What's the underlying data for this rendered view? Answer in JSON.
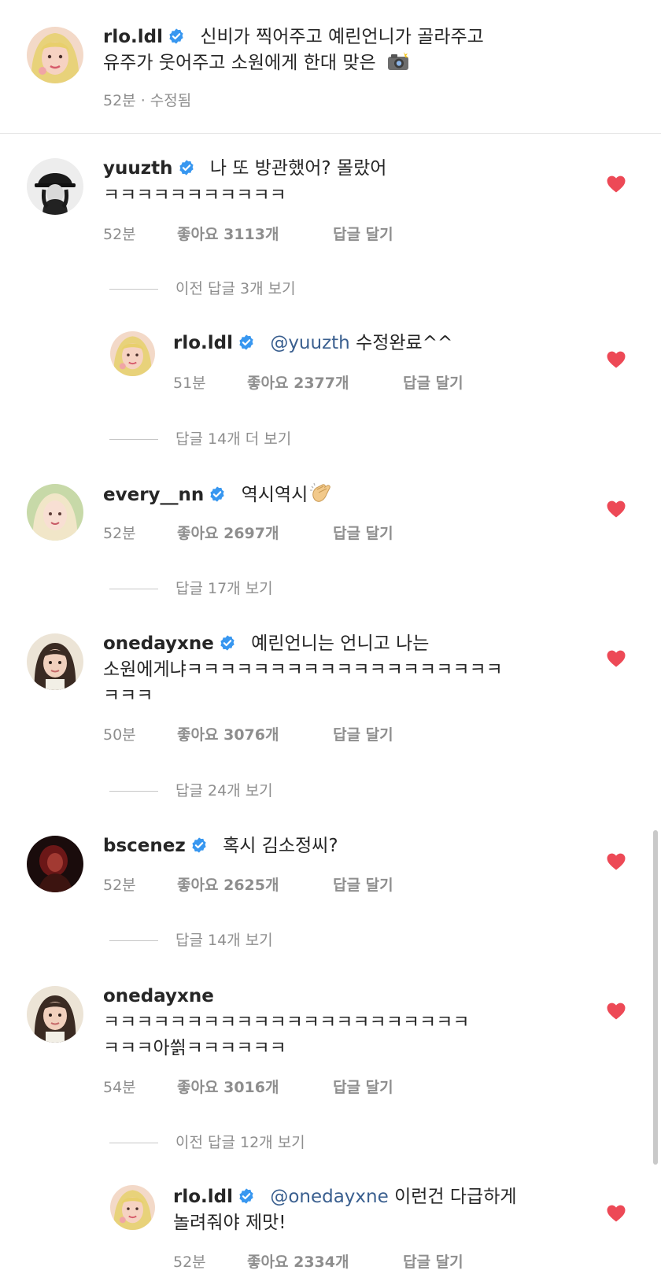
{
  "caption": {
    "username": "rlo.ldl",
    "text_line1": "신비가 찍어주고 예린언니가 골라주고",
    "text_line2": "유주가 웃어주고 소원에게 한대 맞은",
    "emoji": "camera-with-flash-icon",
    "meta": "52분 · 수정됨"
  },
  "comments": [
    {
      "username": "yuuzth",
      "text_line1": "나 또 방관했어? 몰랐어",
      "text_line2": "ㅋㅋㅋㅋㅋㅋㅋㅋㅋㅋㅋ",
      "time": "52분",
      "likes": "좋아요 3113개",
      "reply": "답글 달기",
      "view_replies": "이전 답글 3개 보기"
    },
    {
      "username": "rlo.ldl",
      "mention": "@yuuzth",
      "text_line1": "수정완료^^",
      "time": "51분",
      "likes": "좋아요 2377개",
      "reply": "답글 달기",
      "view_replies": "답글 14개 더 보기"
    },
    {
      "username": "every__nn",
      "text_line1": "역시역시",
      "emoji": "clapping-hands-icon",
      "time": "52분",
      "likes": "좋아요 2697개",
      "reply": "답글 달기",
      "view_replies": "답글 17개 보기"
    },
    {
      "username": "onedayxne",
      "text_line1": "예린언니는 언니고 나는",
      "text_line2": "소원에게냐ㅋㅋㅋㅋㅋㅋㅋㅋㅋㅋㅋㅋㅋㅋㅋㅋㅋㅋㅋ",
      "text_line3": "ㅋㅋㅋ",
      "time": "50분",
      "likes": "좋아요 3076개",
      "reply": "답글 달기",
      "view_replies": "답글 24개 보기"
    },
    {
      "username": "bscenez",
      "text_line1": "혹시 김소정씨?",
      "time": "52분",
      "likes": "좋아요 2625개",
      "reply": "답글 달기",
      "view_replies": "답글 14개 보기"
    },
    {
      "username": "onedayxne",
      "text_line1": "ㅋㅋㅋㅋㅋㅋㅋㅋㅋㅋㅋㅋㅋㅋㅋㅋㅋㅋㅋㅋㅋㅋ",
      "text_line2": "ㅋㅋㅋ아씕ㅋㅋㅋㅋㅋㅋ",
      "time": "54분",
      "likes": "좋아요 3016개",
      "reply": "답글 달기",
      "view_replies": "이전 답글 12개 보기"
    },
    {
      "username": "rlo.ldl",
      "mention": "@onedayxne",
      "text_line1": "이런건 다급하게",
      "text_line2": "놀려줘야 제맛!",
      "time": "52분",
      "likes": "좋아요 2334개",
      "reply": "답글 달기"
    }
  ],
  "colors": {
    "verified": "#3897f0",
    "heart": "#ed4956",
    "mention": "#3a5f8f",
    "meta": "#8e8e8e"
  },
  "icons": {
    "verified": "verified-badge-icon",
    "like": "heart-icon"
  }
}
